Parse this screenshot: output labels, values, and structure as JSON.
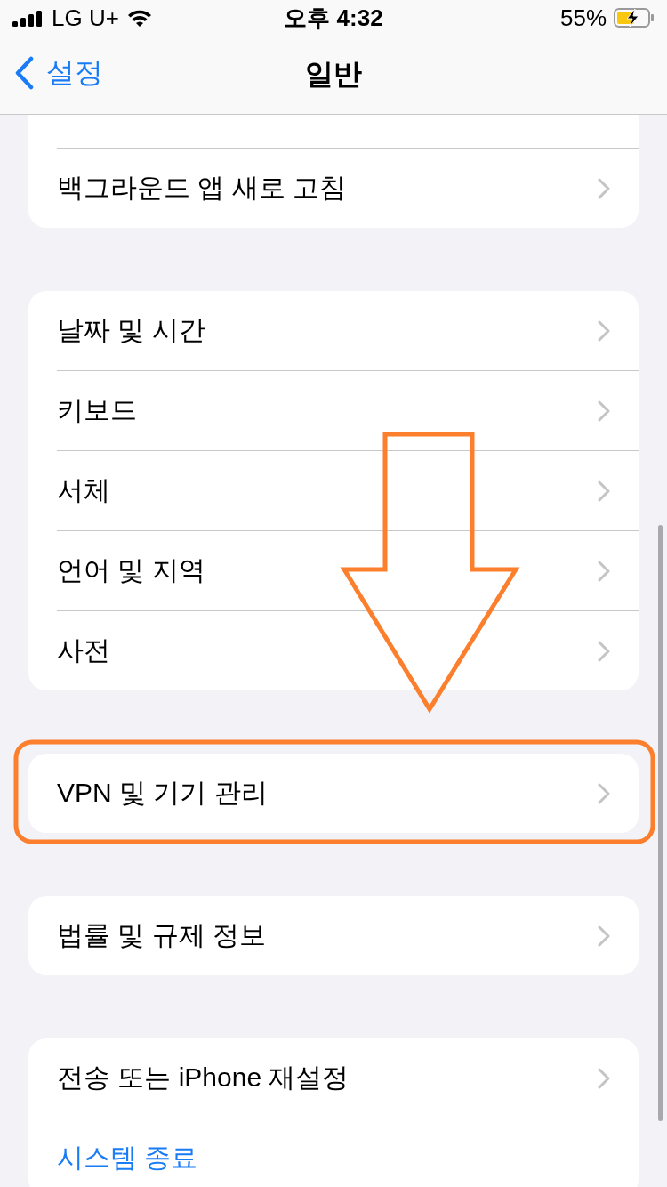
{
  "status_bar": {
    "carrier": "LG U+",
    "time": "오후 4:32",
    "battery_percent": "55%"
  },
  "nav_bar": {
    "back": "설정",
    "title": "일반"
  },
  "groups": [
    {
      "partial_top": true,
      "rows": [
        {
          "label": "백그라운드 앱 새로 고침",
          "kind": "nav"
        }
      ]
    },
    {
      "partial_top": false,
      "rows": [
        {
          "label": "날짜 및 시간",
          "kind": "nav"
        },
        {
          "label": "키보드",
          "kind": "nav"
        },
        {
          "label": "서체",
          "kind": "nav"
        },
        {
          "label": "언어 및 지역",
          "kind": "nav"
        },
        {
          "label": "사전",
          "kind": "nav"
        }
      ]
    },
    {
      "partial_top": false,
      "rows": [
        {
          "label": "VPN 및 기기 관리",
          "kind": "nav"
        }
      ]
    },
    {
      "partial_top": false,
      "rows": [
        {
          "label": "법률 및 규제 정보",
          "kind": "nav"
        }
      ]
    },
    {
      "partial_top": false,
      "rows": [
        {
          "label": "전송 또는 iPhone 재설정",
          "kind": "nav"
        },
        {
          "label": "시스템 종료",
          "kind": "action"
        }
      ]
    }
  ],
  "arrow_annotation": true,
  "highlight_frame": true
}
